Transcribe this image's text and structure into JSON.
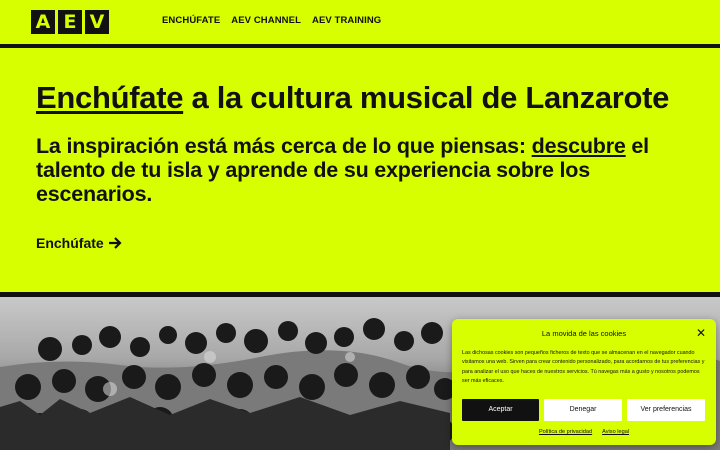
{
  "logo": {
    "letters": [
      "A",
      "E",
      "V"
    ]
  },
  "nav": {
    "items": [
      {
        "label": "ENCHÚFATE"
      },
      {
        "label": "AEV CHANNEL"
      },
      {
        "label": "AEV TRAINING"
      }
    ]
  },
  "hero": {
    "title_link": "Enchúfate",
    "title_rest": " a la cultura musical de Lanzarote",
    "subtitle_before": "La inspiración está más cerca de lo que piensas: ",
    "subtitle_link": "descubre",
    "subtitle_after": " el talento de tu isla y aprende de su experiencia sobre los escenarios.",
    "cta_label": "Enchúfate",
    "cta_icon": "arrow-right-icon"
  },
  "photo": {
    "icon": "crowd-of-musicians-photo"
  },
  "cookie": {
    "title": "La movida de las cookies",
    "close_icon": "close-icon",
    "text": "Las dichosas cookies son pequeños ficheros de texto que se almacenan en el navegador cuando visitamos una web. Sirven para crear contenido personalizado, para acordarnos de tus preferencias y para analizar el uso que haces de nuestros servicios. Tú navegas más a gusto y nosotros podemos ser más eficaces.",
    "accept_label": "Aceptar",
    "deny_label": "Denegar",
    "prefs_label": "Ver preferencias",
    "privacy_link": "Política de privacidad",
    "legal_link": "Aviso legal"
  },
  "colors": {
    "accent": "#d7ff00",
    "dark": "#111111"
  }
}
